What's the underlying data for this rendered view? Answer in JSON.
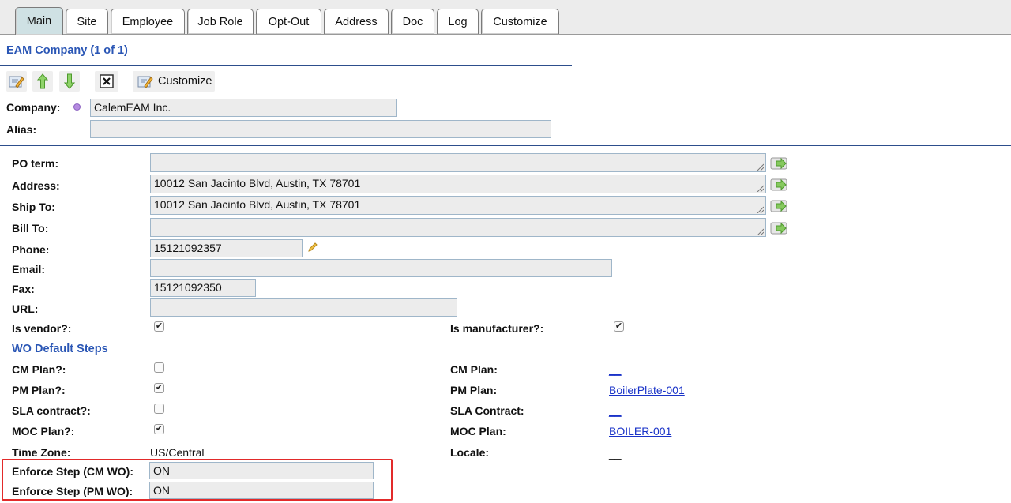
{
  "tabs": [
    {
      "label": "Main",
      "active": true
    },
    {
      "label": "Site"
    },
    {
      "label": "Employee"
    },
    {
      "label": "Job Role"
    },
    {
      "label": "Opt-Out"
    },
    {
      "label": "Address"
    },
    {
      "label": "Doc"
    },
    {
      "label": "Log"
    },
    {
      "label": "Customize"
    }
  ],
  "title": "EAM Company (1 of 1)",
  "toolbar": {
    "icons": [
      "edit-icon",
      "move-up-icon",
      "move-down-icon",
      "close-icon",
      "customize-icon"
    ],
    "customize_label": "Customize"
  },
  "header_fields": {
    "company_label": "Company:",
    "company_value": "CalemEAM Inc.",
    "alias_label": "Alias:",
    "alias_value": ""
  },
  "fields": {
    "po_term_label": "PO term:",
    "po_term_value": "",
    "address_label": "Address:",
    "address_value": "10012 San Jacinto Blvd, Austin, TX 78701",
    "ship_to_label": "Ship To:",
    "ship_to_value": "10012 San Jacinto Blvd, Austin, TX 78701",
    "bill_to_label": "Bill To:",
    "bill_to_value": "",
    "phone_label": "Phone:",
    "phone_value": "15121092357",
    "email_label": "Email:",
    "email_value": "",
    "fax_label": "Fax:",
    "fax_value": "15121092350",
    "url_label": "URL:",
    "url_value": ""
  },
  "flags": {
    "is_vendor_label": "Is vendor?:",
    "is_vendor": true,
    "is_manufacturer_label": "Is manufacturer?:",
    "is_manufacturer": true
  },
  "wo_section_title": "WO Default Steps",
  "wo": {
    "cm_plan_flag_label": "CM Plan?:",
    "cm_plan_flag": false,
    "cm_plan_label": "CM Plan:",
    "cm_plan_value": "__",
    "pm_plan_flag_label": "PM Plan?:",
    "pm_plan_flag": true,
    "pm_plan_label": "PM Plan:",
    "pm_plan_value": "BoilerPlate-001",
    "sla_flag_label": "SLA contract?:",
    "sla_flag": false,
    "sla_label": "SLA Contract:",
    "sla_value": "__",
    "moc_flag_label": "MOC Plan?:",
    "moc_flag": true,
    "moc_label": "MOC Plan:",
    "moc_value": "BOILER-001",
    "time_zone_label": "Time Zone:",
    "time_zone_value": "US/Central",
    "locale_label": "Locale:",
    "locale_value": "__"
  },
  "enforce": {
    "cm_label": "Enforce Step (CM WO):",
    "cm_value": "ON",
    "pm_label": "Enforce Step (PM WO):",
    "pm_value": "ON"
  },
  "colors": {
    "accent": "#2a56b5",
    "active_tab": "#cfe1e4",
    "highlight": "#e22a2a",
    "link": "#1a33c8"
  }
}
